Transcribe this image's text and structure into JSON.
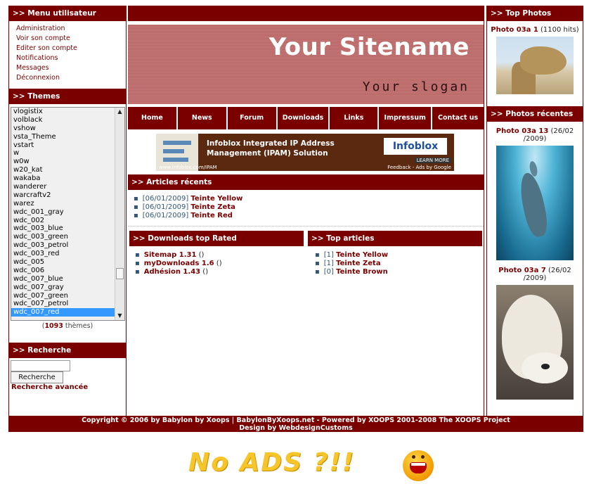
{
  "menu": {
    "title": ">> Menu utilisateur",
    "items": [
      "Administration",
      "Voir son compte",
      "Editer son compte",
      "Notifications",
      "Messages",
      "Déconnexion"
    ]
  },
  "themes": {
    "title": ">> Themes",
    "items": [
      "vlogistix",
      "volblack",
      "vshow",
      "vsta_Theme",
      "vstart",
      "w",
      "w0w",
      "w20_kat",
      "wakaba",
      "wanderer",
      "warcraftv2",
      "warez",
      "wdc_001_gray",
      "wdc_002",
      "wdc_003_blue",
      "wdc_003_green",
      "wdc_003_petrol",
      "wdc_003_red",
      "wdc_005",
      "wdc_006",
      "wdc_007_blue",
      "wdc_007_gray",
      "wdc_007_green",
      "wdc_007_petrol",
      "wdc_007_red"
    ],
    "selected": "wdc_007_red",
    "count_open": "(",
    "count": "1093",
    "count_suffix": " thèmes)"
  },
  "search": {
    "title": ">> Recherche",
    "input_value": "",
    "button": "Recherche",
    "advanced": "Recherche avancée"
  },
  "header": {
    "sitename": "Your Sitename",
    "slogan": "Your slogan"
  },
  "nav": [
    {
      "label": "Home"
    },
    {
      "label": "News"
    },
    {
      "label": "Forum"
    },
    {
      "label": "Downloads"
    },
    {
      "label": "Links"
    },
    {
      "label": "Impressum"
    },
    {
      "label": "Contact us"
    }
  ],
  "ad": {
    "title_line1": "Infoblox Integrated IP Address",
    "title_line2": "Management (IPAM) Solution",
    "brand": "Infoblox",
    "learn": "LEARN MORE",
    "url": "www.infoblox.com/IPAM",
    "footer": "Feedback - Ads by Google"
  },
  "recent_articles": {
    "title": ">> Articles récents",
    "items": [
      {
        "date": "[06/01/2009]",
        "title": "Teinte Yellow"
      },
      {
        "date": "[06/01/2009]",
        "title": "Teinte Zeta"
      },
      {
        "date": "[06/01/2009]",
        "title": "Teinte Red"
      }
    ]
  },
  "downloads": {
    "title": ">> Downloads top Rated",
    "items": [
      {
        "name": "Sitemap 1.31",
        "rating": "()"
      },
      {
        "name": "myDownloads 1.6",
        "rating": "()"
      },
      {
        "name": "Adhésion 1.43",
        "rating": "()"
      }
    ]
  },
  "top_articles": {
    "title": ">> Top articles",
    "items": [
      {
        "count": "[1]",
        "title": "Teinte Yellow"
      },
      {
        "count": "[1]",
        "title": "Teinte Zeta"
      },
      {
        "count": "[0]",
        "title": "Teinte Brown"
      }
    ]
  },
  "top_photos": {
    "title": ">> Top Photos",
    "items": [
      {
        "name": "Photo 03a 1",
        "info": " (1100 hits)"
      }
    ]
  },
  "recent_photos": {
    "title": ">> Photos récentes",
    "items": [
      {
        "name": "Photo 03a 13",
        "info": " (26/02 /2009)"
      },
      {
        "name": "Photo 03a 7",
        "info": " (26/02 /2009)"
      }
    ]
  },
  "footer": {
    "line1": "Copyright © 2006 by Babylon by Xoops  |  BabylonByXoops.net - Powered by XOOPS 2001-2008 The XOOPS Project",
    "line2_prefix": "Design by ",
    "line2_link": "WebdesignCustoms"
  },
  "overlay": {
    "text": "No ADS ?!!"
  },
  "colors": {
    "brand": "#7a0000",
    "link_date": "#335577",
    "selected": "#3399ff"
  }
}
